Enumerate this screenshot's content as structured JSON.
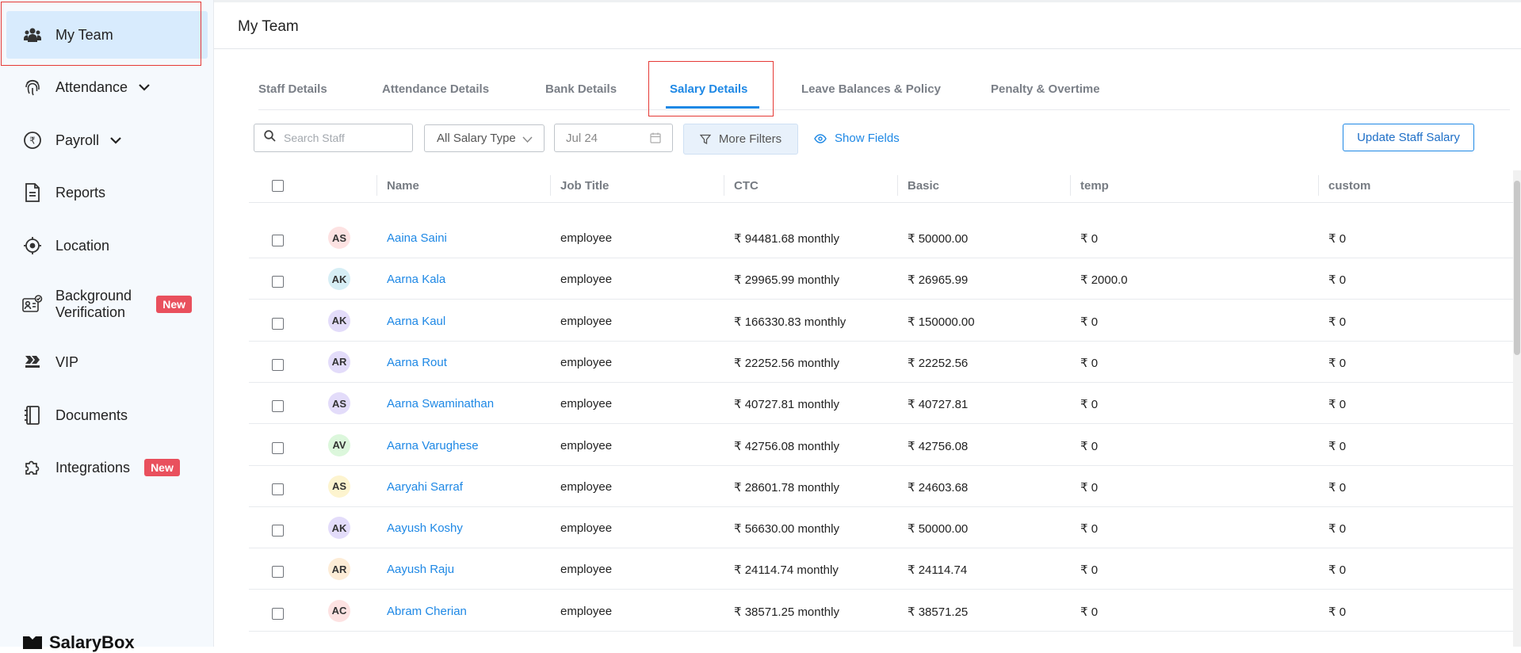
{
  "sidebar": {
    "items": [
      {
        "label": "My Team",
        "icon": "team-icon",
        "active": true
      },
      {
        "label": "Attendance",
        "icon": "fingerprint-icon",
        "chevron": true
      },
      {
        "label": "Payroll",
        "icon": "rupee-icon",
        "chevron": true
      },
      {
        "label": "Reports",
        "icon": "document-icon"
      },
      {
        "label": "Location",
        "icon": "location-target-icon"
      },
      {
        "label": "Background Verification",
        "label_line1": "Background",
        "label_line2": "Verification",
        "icon": "id-check-icon",
        "badge": "New"
      },
      {
        "label": "VIP",
        "icon": "vip-icon"
      },
      {
        "label": "Documents",
        "icon": "notebook-icon"
      },
      {
        "label": "Integrations",
        "icon": "puzzle-icon",
        "badge": "New"
      }
    ],
    "brand": "SalaryBox"
  },
  "header": {
    "title": "My Team"
  },
  "tabs": [
    {
      "label": "Staff Details"
    },
    {
      "label": "Attendance Details"
    },
    {
      "label": "Bank Details"
    },
    {
      "label": "Salary Details",
      "active": true
    },
    {
      "label": "Leave Balances & Policy"
    },
    {
      "label": "Penalty & Overtime"
    }
  ],
  "toolbar": {
    "search_placeholder": "Search Staff",
    "salary_type": "All Salary Type",
    "date": "Jul 24",
    "more_filters": "More Filters",
    "show_fields": "Show Fields",
    "update_button": "Update Staff Salary"
  },
  "table": {
    "columns": [
      "Name",
      "Job Title",
      "CTC",
      "Basic",
      "temp",
      "custom"
    ],
    "rows": [
      {
        "initials": "AS",
        "avatar_color": "#fde2e2",
        "name": "Aaina Saini",
        "job": "employee",
        "ctc": "₹ 94481.68 monthly",
        "basic": "₹ 50000.00",
        "temp": "₹ 0",
        "custom": "₹ 0"
      },
      {
        "initials": "AK",
        "avatar_color": "#d6eef5",
        "name": "Aarna Kala",
        "job": "employee",
        "ctc": "₹ 29965.99 monthly",
        "basic": "₹ 26965.99",
        "temp": "₹ 2000.0",
        "custom": "₹ 0"
      },
      {
        "initials": "AK",
        "avatar_color": "#e3dcfa",
        "name": "Aarna Kaul",
        "job": "employee",
        "ctc": "₹ 166330.83 monthly",
        "basic": "₹ 150000.00",
        "temp": "₹ 0",
        "custom": "₹ 0"
      },
      {
        "initials": "AR",
        "avatar_color": "#e3dcfa",
        "name": "Aarna Rout",
        "job": "employee",
        "ctc": "₹ 22252.56 monthly",
        "basic": "₹ 22252.56",
        "temp": "₹ 0",
        "custom": "₹ 0"
      },
      {
        "initials": "AS",
        "avatar_color": "#e3dcfa",
        "name": "Aarna Swaminathan",
        "job": "employee",
        "ctc": "₹ 40727.81 monthly",
        "basic": "₹ 40727.81",
        "temp": "₹ 0",
        "custom": "₹ 0"
      },
      {
        "initials": "AV",
        "avatar_color": "#dcf7dc",
        "name": "Aarna Varughese",
        "job": "employee",
        "ctc": "₹ 42756.08 monthly",
        "basic": "₹ 42756.08",
        "temp": "₹ 0",
        "custom": "₹ 0"
      },
      {
        "initials": "AS",
        "avatar_color": "#fdf4cf",
        "name": "Aaryahi Sarraf",
        "job": "employee",
        "ctc": "₹ 28601.78 monthly",
        "basic": "₹ 24603.68",
        "temp": "₹ 0",
        "custom": "₹ 0"
      },
      {
        "initials": "AK",
        "avatar_color": "#e3dcfa",
        "name": "Aayush Koshy",
        "job": "employee",
        "ctc": "₹ 56630.00 monthly",
        "basic": "₹ 50000.00",
        "temp": "₹ 0",
        "custom": "₹ 0"
      },
      {
        "initials": "AR",
        "avatar_color": "#fdecd6",
        "name": "Aayush Raju",
        "job": "employee",
        "ctc": "₹ 24114.74 monthly",
        "basic": "₹ 24114.74",
        "temp": "₹ 0",
        "custom": "₹ 0"
      },
      {
        "initials": "AC",
        "avatar_color": "#fde2e2",
        "name": "Abram Cherian",
        "job": "employee",
        "ctc": "₹ 38571.25 monthly",
        "basic": "₹ 38571.25",
        "temp": "₹ 0",
        "custom": "₹ 0"
      }
    ]
  },
  "colors": {
    "accent": "#1e88e5",
    "badge": "#e9505d",
    "active_nav": "#d8ebfd"
  }
}
